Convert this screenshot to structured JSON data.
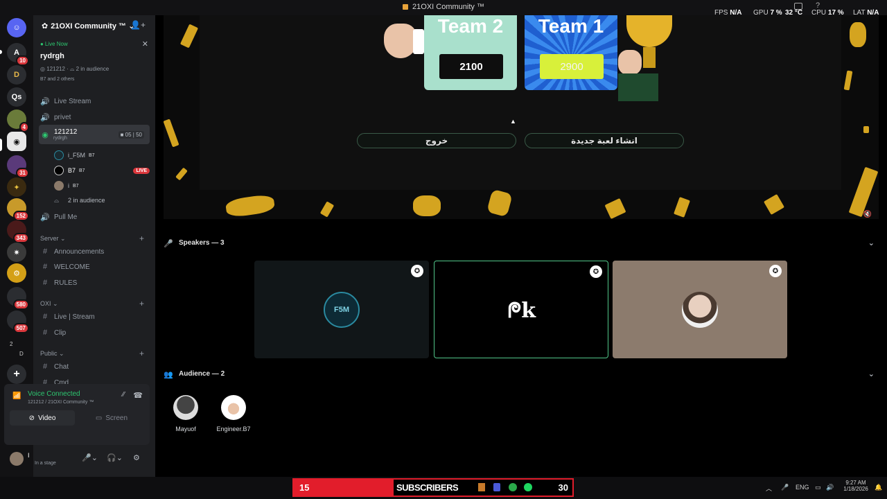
{
  "window": {
    "title": "21OXI Community ™",
    "stats": [
      {
        "label": "FPS",
        "value": "N/A"
      },
      {
        "label": "GPU",
        "value": "7 %"
      },
      {
        "label": "",
        "value": "32 °C"
      },
      {
        "label": "CPU",
        "value": "17 %"
      },
      {
        "label": "LAT",
        "value": "N/A"
      }
    ]
  },
  "rail": {
    "servers": [
      {
        "icon": "discord-icon",
        "badge": ""
      },
      {
        "icon": "a-icon",
        "badge": "10"
      },
      {
        "icon": "d-icon",
        "badge": ""
      },
      {
        "icon": "text",
        "text": "Qs",
        "badge": ""
      },
      {
        "icon": "avatar",
        "badge": "4"
      },
      {
        "icon": "shadow-icon",
        "badge": ""
      },
      {
        "icon": "avatar",
        "badge": "31"
      },
      {
        "icon": "avatar",
        "badge": ""
      },
      {
        "icon": "avatar",
        "badge": "152"
      },
      {
        "icon": "avatar",
        "badge": "343"
      },
      {
        "icon": "avatar",
        "badge": ""
      },
      {
        "icon": "avatar",
        "badge": ""
      },
      {
        "icon": "avatar",
        "badge": "580"
      },
      {
        "icon": "avatar",
        "badge": "507"
      }
    ],
    "folder_labels": [
      "2",
      "D"
    ]
  },
  "sidebar": {
    "server_name": "21OXI Community ™",
    "live": {
      "status": "Live Now",
      "stage_name": "rydrgh",
      "channel": "121212",
      "audience": "2 in audience",
      "others": "B7 and 2 others"
    },
    "channels_top": [
      {
        "name": "Live Stream"
      },
      {
        "name": "privet"
      }
    ],
    "active_channel": {
      "name": "121212",
      "sub": "rydrgh",
      "video_count": "05",
      "user_count": "50"
    },
    "members": [
      {
        "name": "i_F5M",
        "tag": "B7",
        "live": false
      },
      {
        "name": "B7",
        "tag": "B7",
        "live": true
      },
      {
        "name": "i",
        "tag": "B7",
        "live": false
      }
    ],
    "audience_line": "2 in audience",
    "live_badge": "LIVE",
    "channel_after": "Pull Me",
    "categories": [
      {
        "name": "Server",
        "channels": [
          "Announcements",
          "WELCOME",
          "RULES"
        ]
      },
      {
        "name": "OXI",
        "channels": [
          "Live | Stream",
          "Clip"
        ]
      },
      {
        "name": "Public",
        "channels": [
          "Chat",
          "Cmd"
        ]
      }
    ]
  },
  "voice": {
    "status": "Voice Connected",
    "location": "121212 / 21OXI Community ™",
    "video_label": "Video",
    "screen_label": "Screen"
  },
  "user": {
    "name": "I",
    "status": "In a stage"
  },
  "stage": {
    "team2": {
      "name": "Team 2",
      "score": "2100"
    },
    "team1": {
      "name": "Team 1",
      "score": "2900"
    },
    "exit_button": "خروج",
    "new_game_button": "انشاء لعبة جديدة"
  },
  "speakers": {
    "header": "Speakers — 3",
    "tiles": [
      {
        "name": "i_F5M",
        "avatar_text": "F5M",
        "bg": "#111618"
      },
      {
        "name": "B7",
        "avatar_text": "ᖘk",
        "bg": "#000000"
      },
      {
        "name": "i",
        "avatar_text": "",
        "bg": "#8c7b6d"
      }
    ]
  },
  "audience": {
    "header": "Audience — 2",
    "members": [
      {
        "name": "Mayuof"
      },
      {
        "name": "Engineer.B7"
      }
    ]
  },
  "taskbar": {
    "subs_left": "15",
    "subs_label": "SUBSCRIBERS",
    "subs_right": "30",
    "language": "ENG",
    "time": "9:27 AM",
    "date": "1/18/2026"
  },
  "colors": {
    "accent_green": "#2dc770",
    "live_red": "#da373c",
    "team2_card": "#a9e0cc",
    "team1_card": "#2a74d8",
    "team1_score": "#d8f03a",
    "confetti_gold": "#d4a420"
  }
}
